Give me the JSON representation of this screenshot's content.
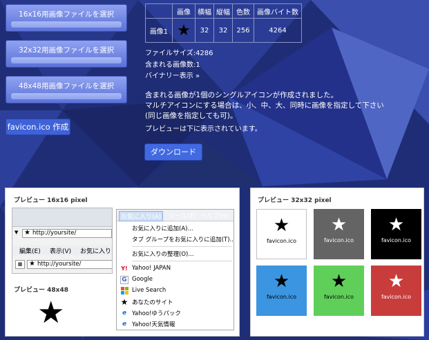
{
  "select_buttons": [
    {
      "label": "16x16用画像ファイルを選択"
    },
    {
      "label": "32x32用画像ファイルを選択"
    },
    {
      "label": "48x48用画像ファイルを選択"
    }
  ],
  "make_button": {
    "label": "favicon.ico 作成"
  },
  "info_table": {
    "headers": [
      "",
      "画像",
      "横幅",
      "縦幅",
      "色数",
      "画像バイト数"
    ],
    "rows": [
      {
        "name": "画像1",
        "icon": "★",
        "width": "32",
        "height": "32",
        "colors": "256",
        "bytes": "4264"
      }
    ]
  },
  "file_info": {
    "size": "ファイルサイズ:4286",
    "count": "含まれる画像数:1",
    "binary_link": "バイナリー表示 »"
  },
  "message": {
    "line1": "含まれる画像が1個のシングルアイコンが作成されました。",
    "line2": "マルチアイコンにする場合は、小、中、大、同時に画像を指定して下さい",
    "line3": "(同じ画像を指定しても可)。",
    "line4": "プレビューは下に表示されています。"
  },
  "download_button": {
    "label": "ダウンロード"
  },
  "preview16": {
    "title": "プレビュー 16x16 pixel",
    "address": "http://yoursite/",
    "toolbar": [
      "編集(E)",
      "表示(V)",
      "お気に入り"
    ],
    "address2": "http://yoursite/",
    "menubar": [
      "お気に入り(A)",
      "ツール(T)",
      "ヘルプ(H)"
    ],
    "menu_items": [
      "お気に入りに追加(A)...",
      "タブ グループをお気に入りに追加(T)...",
      "お気に入りの整理(O)..."
    ],
    "favorites": [
      {
        "icon": "yahoo-icon",
        "label": "Yahoo! JAPAN"
      },
      {
        "icon": "google-icon",
        "label": "Google"
      },
      {
        "icon": "windows-icon",
        "label": "Live Search"
      },
      {
        "icon": "star-icon",
        "label": "あなたのサイト"
      },
      {
        "icon": "ie-icon",
        "label": "Yahoo!ゆうパック"
      },
      {
        "icon": "ie-icon",
        "label": "Yahoo!天気情報"
      }
    ]
  },
  "preview48": {
    "title": "プレビュー 48x48"
  },
  "preview32": {
    "title": "プレビュー 32x32 pixel",
    "swatches": [
      {
        "bg": "#ffffff",
        "fg": "#000000",
        "label": "favicon.ico"
      },
      {
        "bg": "#646464",
        "fg": "#ffffff",
        "label": "favicon.ico"
      },
      {
        "bg": "#000000",
        "fg": "#ffffff",
        "label": "favicon.ico"
      },
      {
        "bg": "#3b95e0",
        "fg": "#000000",
        "label": "favicon.ico"
      },
      {
        "bg": "#5fcf5a",
        "fg": "#000000",
        "label": "favicon.ico"
      },
      {
        "bg": "#c83c3c",
        "fg": "#ffffff",
        "label": "favicon.ico"
      }
    ]
  }
}
